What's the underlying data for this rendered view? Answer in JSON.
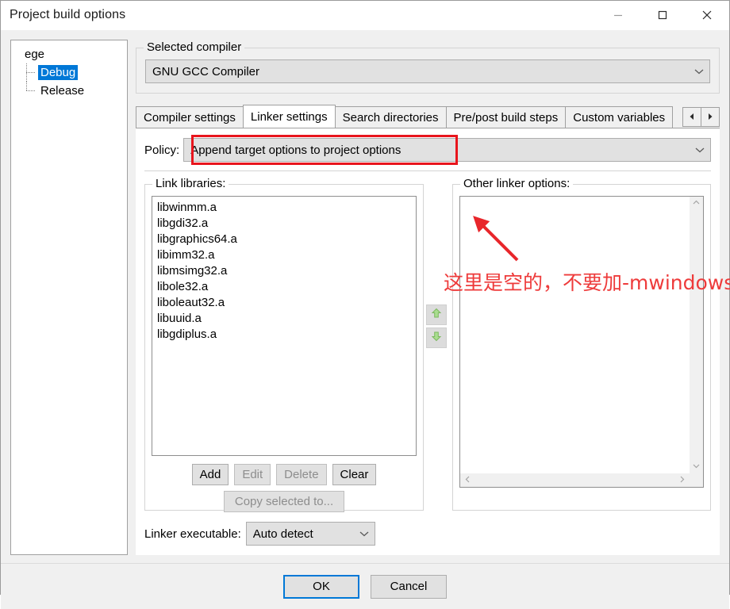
{
  "window": {
    "title": "Project build options",
    "caption_buttons": [
      {
        "name": "minimize",
        "glyph": "minimize-icon"
      },
      {
        "name": "maximize",
        "glyph": "maximize-icon"
      },
      {
        "name": "close",
        "glyph": "close-icon"
      }
    ]
  },
  "tree": {
    "root": "ege",
    "children": [
      {
        "label": "Debug",
        "selected": true
      },
      {
        "label": "Release",
        "selected": false
      }
    ]
  },
  "compiler_group": {
    "title": "Selected compiler",
    "selected": "GNU GCC Compiler"
  },
  "tabs": {
    "items": [
      {
        "label": "Compiler settings",
        "active": false
      },
      {
        "label": "Linker settings",
        "active": true
      },
      {
        "label": "Search directories",
        "active": false
      },
      {
        "label": "Pre/post build steps",
        "active": false
      },
      {
        "label": "Custom variables",
        "active": false
      }
    ],
    "nav_prev": "◀",
    "nav_next": "▶"
  },
  "policy": {
    "label": "Policy:",
    "value": "Append target options to project options",
    "highlight_color": "#e8151d"
  },
  "link_libraries": {
    "title": "Link libraries:",
    "items": [
      "libwinmm.a",
      "libgdi32.a",
      "libgraphics64.a",
      "libimm32.a",
      "libmsimg32.a",
      "libole32.a",
      "liboleaut32.a",
      "libuuid.a",
      "libgdiplus.a"
    ],
    "buttons": [
      {
        "label": "Add",
        "enabled": true
      },
      {
        "label": "Edit",
        "enabled": false
      },
      {
        "label": "Delete",
        "enabled": false
      },
      {
        "label": "Clear",
        "enabled": true
      }
    ],
    "copy_selected": {
      "label": "Copy selected to...",
      "enabled": false
    }
  },
  "move_buttons": [
    {
      "name": "move-up",
      "glyph": "arrow-up-icon"
    },
    {
      "name": "move-down",
      "glyph": "arrow-down-icon"
    }
  ],
  "other_linker_options": {
    "title": "Other linker options:",
    "value": ""
  },
  "annotation": {
    "text": "这里是空的，不要加-mwindows",
    "color": "#ee3b3b",
    "arrow": "red-arrow-icon"
  },
  "linker_executable": {
    "label": "Linker executable:",
    "value": "Auto detect"
  },
  "footer": {
    "ok": "OK",
    "cancel": "Cancel"
  }
}
